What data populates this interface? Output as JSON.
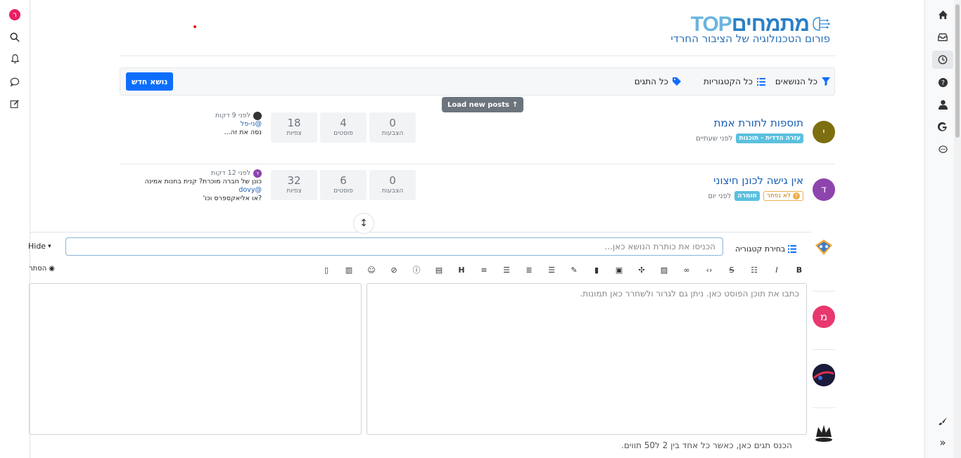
{
  "header": {
    "logo_hebrew": "מתמחים",
    "logo_latin": "TOP",
    "tagline": "פורום הטכנולוגיה של הציבור החרדי"
  },
  "left_sidebar": {
    "user_initial": "ר",
    "items": [
      "search-icon",
      "bell-icon",
      "chat-icon",
      "edit-icon"
    ]
  },
  "right_sidebar": {
    "items": [
      "home-icon",
      "inbox-icon",
      "clock-icon",
      "help-icon",
      "user-icon",
      "google-icon",
      "comment-icon"
    ],
    "bottom": [
      "brush-icon",
      "expand-icon"
    ]
  },
  "toolbar": {
    "all_topics": "כל הנושאים",
    "all_categories": "כל הקטגוריות",
    "all_tags": "כל התגים",
    "new_topic": "נושא חדש",
    "load_new_posts": "Load new posts"
  },
  "topics": [
    {
      "avatar_letter": "י",
      "avatar_color": "#7d6e0f",
      "title": "תוספות לתורת אמת",
      "category": "עזרה הדדית - תוכנות",
      "category_color": "#5bc0de",
      "time": "לפני שעתיים",
      "votes": "0",
      "votes_label": "הצבעות",
      "posts": "4",
      "posts_label": "פוסטים",
      "views": "18",
      "views_label": "צפיות",
      "teaser_time": "לפני 9 דקות",
      "teaser_mention": "@ני-פל",
      "teaser_text": "נסה את זה..."
    },
    {
      "avatar_letter": "ד",
      "avatar_color": "#8e44ad",
      "title": "אין גישה לכונן חיצוני",
      "status": "לא נפתר",
      "category": "חומרה",
      "category_color": "#5bc0de",
      "time": "לפני יום",
      "votes": "0",
      "votes_label": "הצבעות",
      "posts": "6",
      "posts_label": "פוסטים",
      "views": "32",
      "views_label": "צפיות",
      "teaser_time": "לפני 12 דקות",
      "teaser_text": "כונן של חברה מוכרת? קנית בחנות אמינה",
      "teaser_mention": "@dovy",
      "teaser_text2": "?או אליאקספרס וכו'"
    }
  ],
  "composer": {
    "category_select": "בחירת קטגוריה",
    "title_placeholder": "הכניסו את כותרת הנושא כאן...",
    "hide_label": "Hide",
    "preview_label": "הסתר",
    "editor_placeholder": "כתבו את תוכן הפוסט כאן. ניתן גם לגרור ולשחרר כאן תמונות.",
    "tags_hint": "הכנס תגים כאן, כאשר כל אחד בין 2 ל50 תווים.",
    "format_buttons": [
      "B",
      "I",
      "list",
      "strike",
      "code",
      "link",
      "image",
      "expand",
      "media",
      "chart",
      "pen",
      "align-left",
      "align-center",
      "align-right",
      "align-justify",
      "H",
      "file",
      "info",
      "hide",
      "emoji",
      "pdf",
      "doc"
    ]
  },
  "side_avatars": [
    {
      "letter": "",
      "color": "#ffffff"
    },
    {
      "letter": "מ",
      "color": "#e8386d"
    },
    {
      "letter": "",
      "color": "#1a1a3a"
    },
    {
      "letter": "",
      "color": "#ffffff"
    }
  ]
}
